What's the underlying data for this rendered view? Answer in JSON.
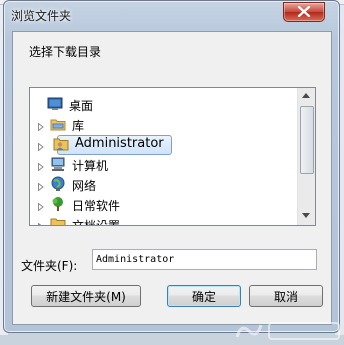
{
  "window": {
    "title": "浏览文件夹"
  },
  "dialog": {
    "prompt": "选择下载目录"
  },
  "tree": {
    "items": [
      {
        "label": "桌面",
        "icon": "desktop-icon",
        "expander": false,
        "selected": false
      },
      {
        "label": "库",
        "icon": "library-folder-icon",
        "expander": true,
        "selected": false
      },
      {
        "label": "Administrator",
        "icon": "user-folder-icon",
        "expander": true,
        "selected": true
      },
      {
        "label": "计算机",
        "icon": "computer-icon",
        "expander": true,
        "selected": false
      },
      {
        "label": "网络",
        "icon": "network-icon",
        "expander": true,
        "selected": false
      },
      {
        "label": "日常软件",
        "icon": "tree-folder-icon",
        "expander": true,
        "selected": false
      },
      {
        "label": "文档设置",
        "icon": "folder-icon",
        "expander": true,
        "selected": false
      }
    ]
  },
  "folder_field": {
    "label": "文件夹(F):",
    "value": "Administrator"
  },
  "buttons": {
    "new_folder": "新建文件夹(M)",
    "ok": "确定",
    "cancel": "取消"
  },
  "colors": {
    "selection_border": "#7da2ce",
    "selection_fill": "#cfe3fa",
    "close_red": "#c7463a"
  }
}
